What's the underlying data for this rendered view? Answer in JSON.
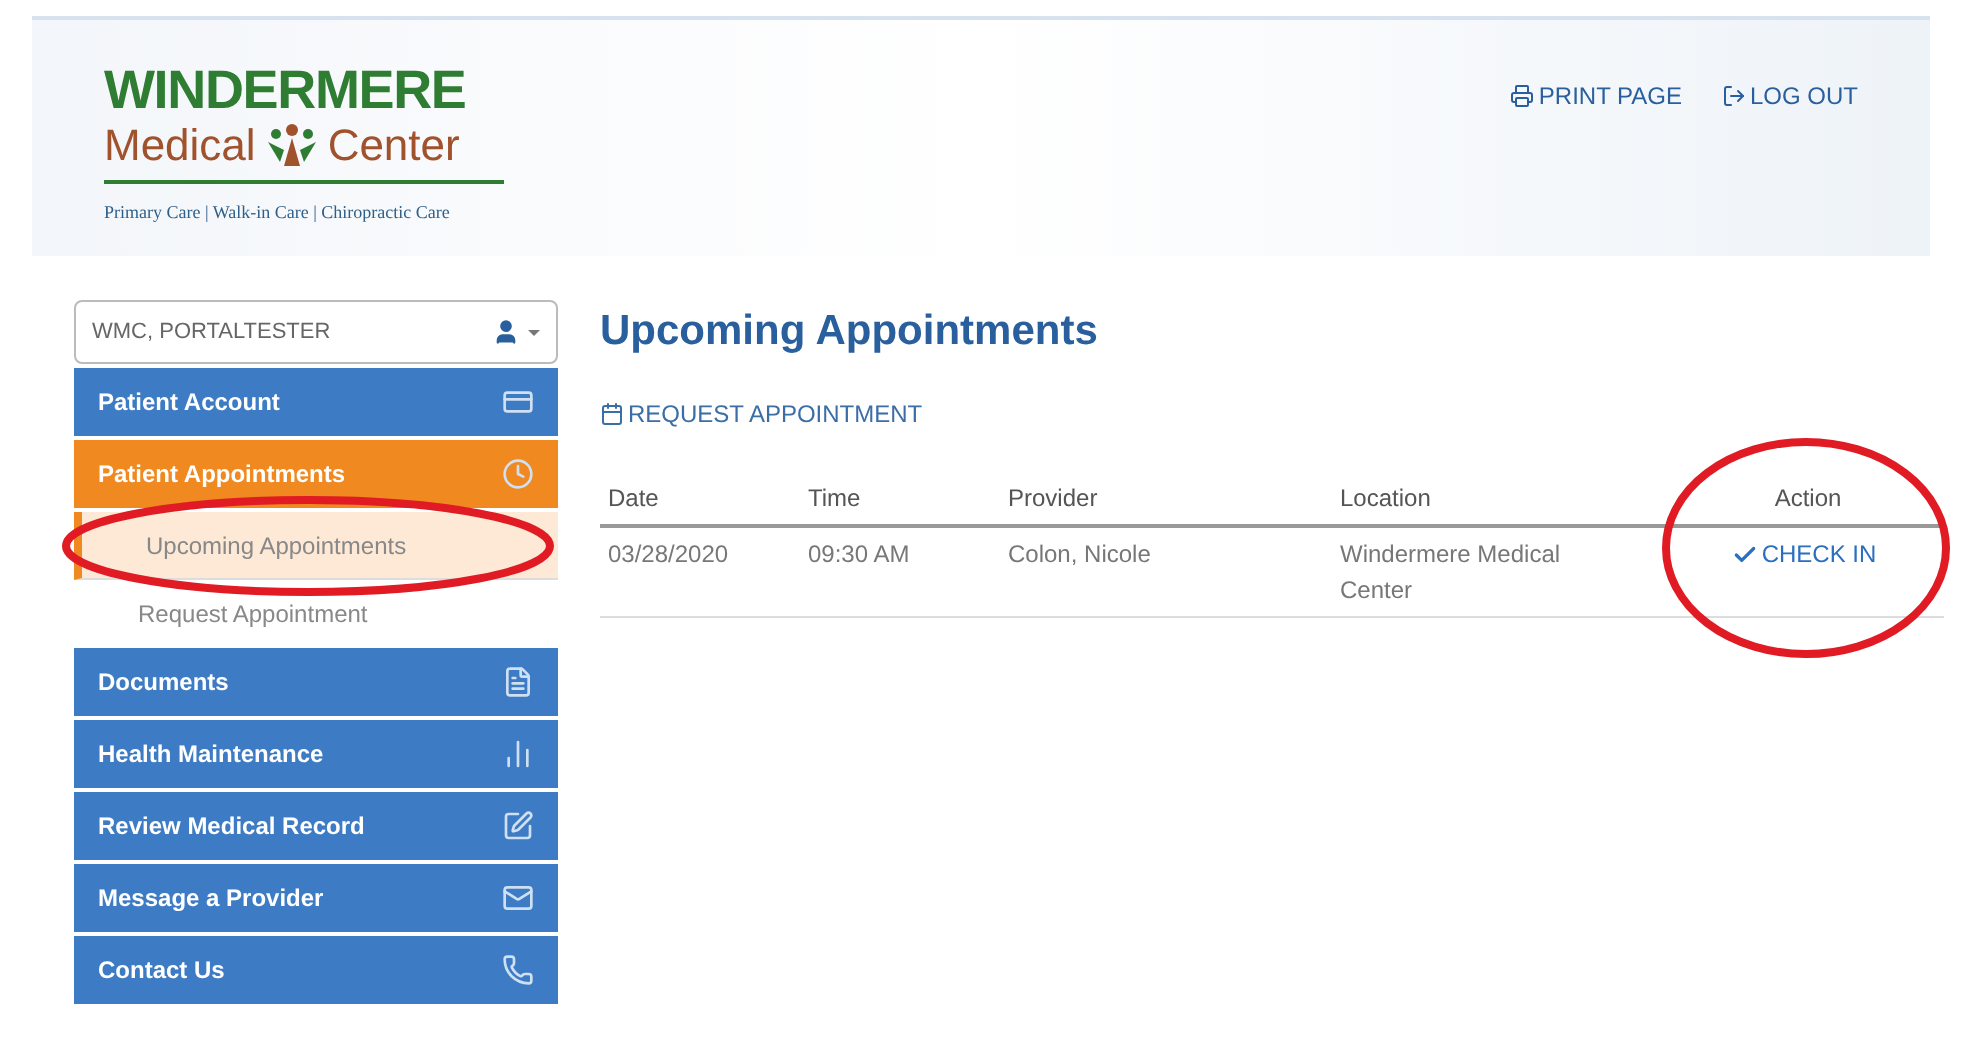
{
  "logo": {
    "line1": "WINDERMERE",
    "line2a": "Medical",
    "line2b": "Center",
    "tagline": "Primary Care | Walk-in Care | Chiropractic Care"
  },
  "header_links": [
    {
      "label": "PRINT PAGE",
      "kind": "print"
    },
    {
      "label": "LOG OUT",
      "kind": "logout"
    }
  ],
  "user_menu": {
    "value": "WMC, PORTALTESTER"
  },
  "sidebar": {
    "items": [
      {
        "label": "Patient Account",
        "selected": false
      },
      {
        "label": "Patient Appointments",
        "selected": true,
        "children": [
          {
            "label": "Upcoming Appointments",
            "selected": true
          },
          {
            "label": "Request Appointment",
            "selected": false
          }
        ]
      },
      {
        "label": "Documents",
        "selected": false
      },
      {
        "label": "Health Maintenance",
        "selected": false
      },
      {
        "label": "Review Medical Record",
        "selected": false
      },
      {
        "label": "Message a Provider",
        "selected": false
      },
      {
        "label": "Contact Us",
        "selected": false
      }
    ]
  },
  "page_title": "Upcoming Appointments",
  "request_link": "REQUEST APPOINTMENT",
  "table": {
    "columns": [
      "Date",
      "Time",
      "Provider",
      "Location",
      "Action"
    ],
    "rows": [
      {
        "cells": [
          "03/28/2020",
          "09:30 AM",
          "Colon, Nicole",
          "Windermere Medical Center"
        ],
        "action": "CHECK IN"
      }
    ]
  }
}
